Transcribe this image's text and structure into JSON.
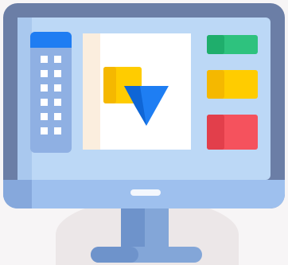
{
  "icon": "desktop-monitor-design-app-icon",
  "colors": {
    "monitor_frame": "#6b7ea6",
    "monitor_frame_shadow": "#5a6c93",
    "screen": "#bcd8f6",
    "screen_shadow": "#a9c8ee",
    "chin": "#9ec0ee",
    "chin_shadow": "#86a8dc",
    "power_button": "#f3f7fd",
    "stand": "#83a6d8",
    "stand_shadow": "#6e93cb",
    "sidebar": "#8fb0e3",
    "sidebar_header": "#1f7df2",
    "sidebar_dots": "#ffffff",
    "panel_strip": "#fbeede",
    "canvas": "#ffffff",
    "yellow_square": "#ffcc00",
    "blue_triangle": "#1e7ef3",
    "swatch_green": "#2ec27e",
    "swatch_yellow": "#ffcc00",
    "swatch_red": "#f5525d"
  }
}
